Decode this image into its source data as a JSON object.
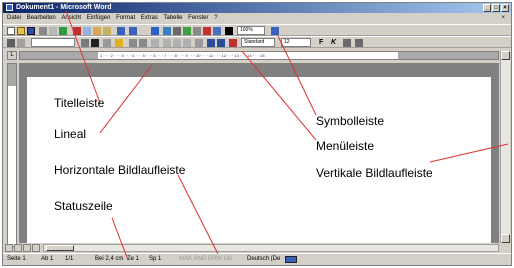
{
  "window": {
    "title": "Dokument1 - Microsoft Word",
    "controls": {
      "minimize": "_",
      "maximize": "□",
      "close": "×"
    }
  },
  "menu": {
    "items": [
      "Datei",
      "Bearbeiten",
      "Ansicht",
      "Einfügen",
      "Format",
      "Extras",
      "Tabelle",
      "Fenster",
      "?"
    ],
    "close_doc": "×"
  },
  "toolbar": {
    "zoom": "100%",
    "style": "Standard",
    "font_size": "12",
    "bold": "F",
    "italic": "K"
  },
  "ruler": {
    "marks": "1 · · · 2 · · · 3 · · · 4 · · · 5 · · · 6 · · · 7 · · · 8 · · · 9 · · · 10 · · · 11 · · · 12 · · · 13 · · · 14 · · · 15"
  },
  "statusbar": {
    "page": "Seite 1",
    "section": "Ab 1",
    "pages": "1/1",
    "position": "Bei 2,4 cm",
    "line": "Ze 1",
    "column": "Sp 1",
    "modes": "MAK  ÄND  ERW  ÜB",
    "language": "Deutsch (De"
  },
  "annotations": {
    "titelleiste": "Titelleiste",
    "lineal": "Lineal",
    "horizontal": "Horizontale Bildlaufleiste",
    "statuszeile": "Statuszeile",
    "symbolleiste": "Symbolleiste",
    "menueleiste": "Menüleiste",
    "vertikal": "Vertikale Bildlaufleiste"
  },
  "colors": {
    "title_gradient_start": "#0a246a",
    "title_gradient_end": "#a6caf0",
    "window_face": "#d4d0c8",
    "leader_lines": "#e03030"
  }
}
